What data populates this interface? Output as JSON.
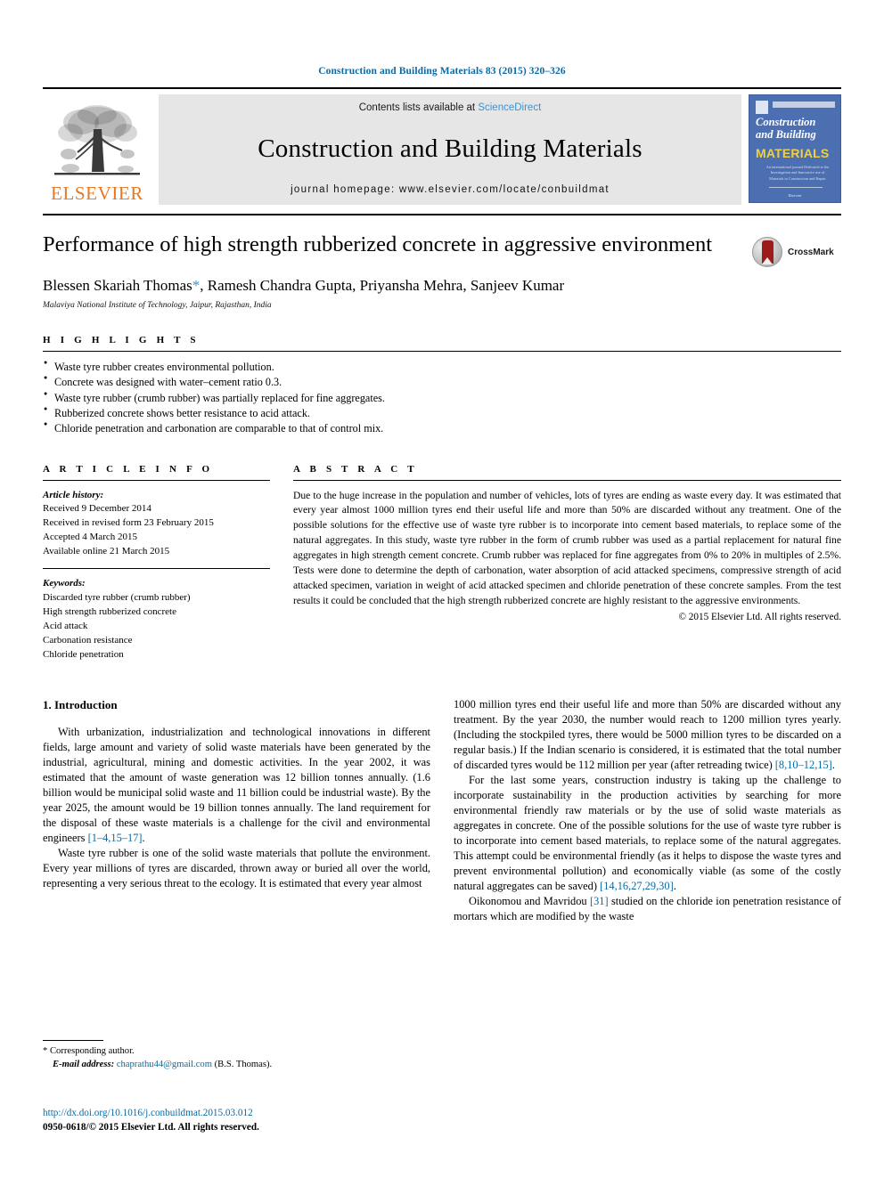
{
  "running_head": "Construction and Building Materials 83 (2015) 320–326",
  "banner": {
    "contents_prefix": "Contents lists available at ",
    "sciencedirect": "ScienceDirect",
    "journal_title": "Construction and Building Materials",
    "homepage": "journal homepage: www.elsevier.com/locate/conbuildmat",
    "publisher_wordmark": "ELSEVIER",
    "cover": {
      "line1": "Construction",
      "line2": "and Building",
      "line3": "MATERIALS",
      "blurb": "An international journal Dedicated to the Investigation and Innovative use of Materials in Construction and Repair",
      "footer": "Elsevier"
    }
  },
  "article": {
    "title": "Performance of high strength rubberized concrete in aggressive environment",
    "authors": "Blessen Skariah Thomas",
    "corresponding_mark": "*",
    "authors_rest": ", Ramesh Chandra Gupta, Priyansha Mehra, Sanjeev Kumar",
    "affiliation": "Malaviya National Institute of Technology, Jaipur, Rajasthan, India",
    "crossmark_label": "CrossMark"
  },
  "highlights": {
    "heading": "H I G H L I G H T S",
    "items": [
      "Waste tyre rubber creates environmental pollution.",
      "Concrete was designed with water–cement ratio 0.3.",
      "Waste tyre rubber (crumb rubber) was partially replaced for fine aggregates.",
      "Rubberized concrete shows better resistance to acid attack.",
      "Chloride penetration and carbonation are comparable to that of control mix."
    ]
  },
  "article_info": {
    "heading": "A R T I C L E    I N F O",
    "history_label": "Article history:",
    "history": [
      "Received 9 December 2014",
      "Received in revised form 23 February 2015",
      "Accepted 4 March 2015",
      "Available online 21 March 2015"
    ],
    "keywords_label": "Keywords:",
    "keywords": [
      "Discarded tyre rubber (crumb rubber)",
      "High strength rubberized concrete",
      "Acid attack",
      "Carbonation resistance",
      "Chloride penetration"
    ]
  },
  "abstract": {
    "heading": "A B S T R A C T",
    "text": "Due to the huge increase in the population and number of vehicles, lots of tyres are ending as waste every day. It was estimated that every year almost 1000 million tyres end their useful life and more than 50% are discarded without any treatment. One of the possible solutions for the effective use of waste tyre rubber is to incorporate into cement based materials, to replace some of the natural aggregates. In this study, waste tyre rubber in the form of crumb rubber was used as a partial replacement for natural fine aggregates in high strength cement concrete. Crumb rubber was replaced for fine aggregates from 0% to 20% in multiples of 2.5%. Tests were done to determine the depth of carbonation, water absorption of acid attacked specimens, compressive strength of acid attacked specimen, variation in weight of acid attacked specimen and chloride penetration of these concrete samples. From the test results it could be concluded that the high strength rubberized concrete are highly resistant to the aggressive environments.",
    "copyright": "© 2015 Elsevier Ltd. All rights reserved."
  },
  "body": {
    "section_heading": "1. Introduction",
    "left": {
      "para1_a": "With urbanization, industrialization and technological innovations in different fields, large amount and variety of solid waste materials have been generated by the industrial, agricultural, mining and domestic activities. In the year 2002, it was estimated that the amount of waste generation was 12 billion tonnes annually. (1.6 billion would be municipal solid waste and 11 billion could be industrial waste). By the year 2025, the amount would be 19 billion tonnes annually. The land requirement for the disposal of these waste materials is a challenge for the civil and environmental engineers ",
      "para1_ref": "[1–4,15–17]",
      "para1_b": ".",
      "para2": "Waste tyre rubber is one of the solid waste materials that pollute the environment. Every year millions of tyres are discarded, thrown away or buried all over the world, representing a very serious threat to the ecology. It is estimated that every year almost"
    },
    "right": {
      "para2_cont_a": "1000 million tyres end their useful life and more than 50% are discarded without any treatment. By the year 2030, the number would reach to 1200 million tyres yearly. (Including the stockpiled tyres, there would be 5000 million tyres to be discarded on a regular basis.) If the Indian scenario is considered, it is estimated that the total number of discarded tyres would be 112 million per year (after retreading twice) ",
      "para2_cont_ref": "[8,10–12,15]",
      "para2_cont_b": ".",
      "para3_a": "For the last some years, construction industry is taking up the challenge to incorporate sustainability in the production activities by searching for more environmental friendly raw materials or by the use of solid waste materials as aggregates in concrete. One of the possible solutions for the use of waste tyre rubber is to incorporate into cement based materials, to replace some of the natural aggregates. This attempt could be environmental friendly (as it helps to dispose the waste tyres and prevent environmental pollution) and economically viable (as some of the costly natural aggregates can be saved) ",
      "para3_ref": "[14,16,27,29,30]",
      "para3_b": ".",
      "para4_a": "Oikonomou and Mavridou ",
      "para4_ref": "[31]",
      "para4_b": " studied on the chloride ion penetration resistance of mortars which are modified by the waste"
    }
  },
  "footer": {
    "corresponding_star": "*",
    "corresponding_text": "Corresponding author.",
    "email_label": "E-mail address:",
    "email": "chaprathu44@gmail.com",
    "email_owner": "(B.S. Thomas).",
    "doi": "http://dx.doi.org/10.1016/j.conbuildmat.2015.03.012",
    "issn_line": "0950-0618/© 2015 Elsevier Ltd. All rights reserved."
  },
  "colors": {
    "link_blue": "#0b6aa2",
    "sciencedirect_blue": "#3a93d0",
    "elsevier_orange": "#E87722",
    "banner_gray": "#e6e6e6",
    "cover_blue": "#4c6fb1",
    "cover_yellow": "#f2d03c"
  }
}
